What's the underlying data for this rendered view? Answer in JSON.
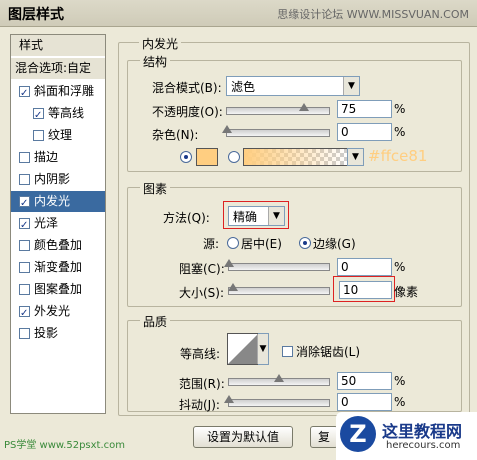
{
  "window": {
    "title": "图层样式",
    "watermark": "思缘设计论坛  WWW.MISSVUAN.COM"
  },
  "sidebar": {
    "style_header": "样式",
    "blend_header": "混合选项:自定",
    "items": [
      {
        "label": "斜面和浮雕",
        "checked": true
      },
      {
        "label": "等高线",
        "checked": true
      },
      {
        "label": "纹理",
        "checked": false
      },
      {
        "label": "描边",
        "checked": false
      },
      {
        "label": "内阴影",
        "checked": false
      },
      {
        "label": "内发光",
        "checked": true
      },
      {
        "label": "光泽",
        "checked": true
      },
      {
        "label": "颜色叠加",
        "checked": false
      },
      {
        "label": "渐变叠加",
        "checked": false
      },
      {
        "label": "图案叠加",
        "checked": false
      },
      {
        "label": "外发光",
        "checked": true
      },
      {
        "label": "投影",
        "checked": false
      }
    ],
    "footer": "PS学堂 www.52psxt.com"
  },
  "panel_title": "内发光",
  "structure": {
    "title": "结构",
    "blend_mode_label": "混合模式(B):",
    "blend_mode_value": "滤色",
    "opacity_label": "不透明度(O):",
    "opacity_value": "75",
    "opacity_level": 75,
    "noise_label": "杂色(N):",
    "noise_value": "0",
    "noise_level": 0,
    "unit": "%",
    "color_hex": "#ffce81",
    "color_swatch": "#ffce81"
  },
  "elements": {
    "title": "图素",
    "technique_label": "方法(Q):",
    "technique_value": "精确",
    "source_label": "源:",
    "source_center": "居中(E)",
    "source_edge": "边缘(G)",
    "choke_label": "阻塞(C):",
    "choke_value": "0",
    "choke_level": 0,
    "size_label": "大小(S):",
    "size_value": "10",
    "size_level": 4,
    "unit_pct": "%",
    "unit_px": "像素"
  },
  "quality": {
    "title": "品质",
    "contour_label": "等高线:",
    "antialias_label": "消除锯齿(L)",
    "range_label": "范围(R):",
    "range_value": "50",
    "range_level": 50,
    "jitter_label": "抖动(J):",
    "jitter_value": "0",
    "jitter_level": 0,
    "unit": "%"
  },
  "buttons": {
    "default": "设置为默认值",
    "reset": "复"
  },
  "brand": {
    "name": "这里教程网",
    "url": "herecours.com"
  }
}
